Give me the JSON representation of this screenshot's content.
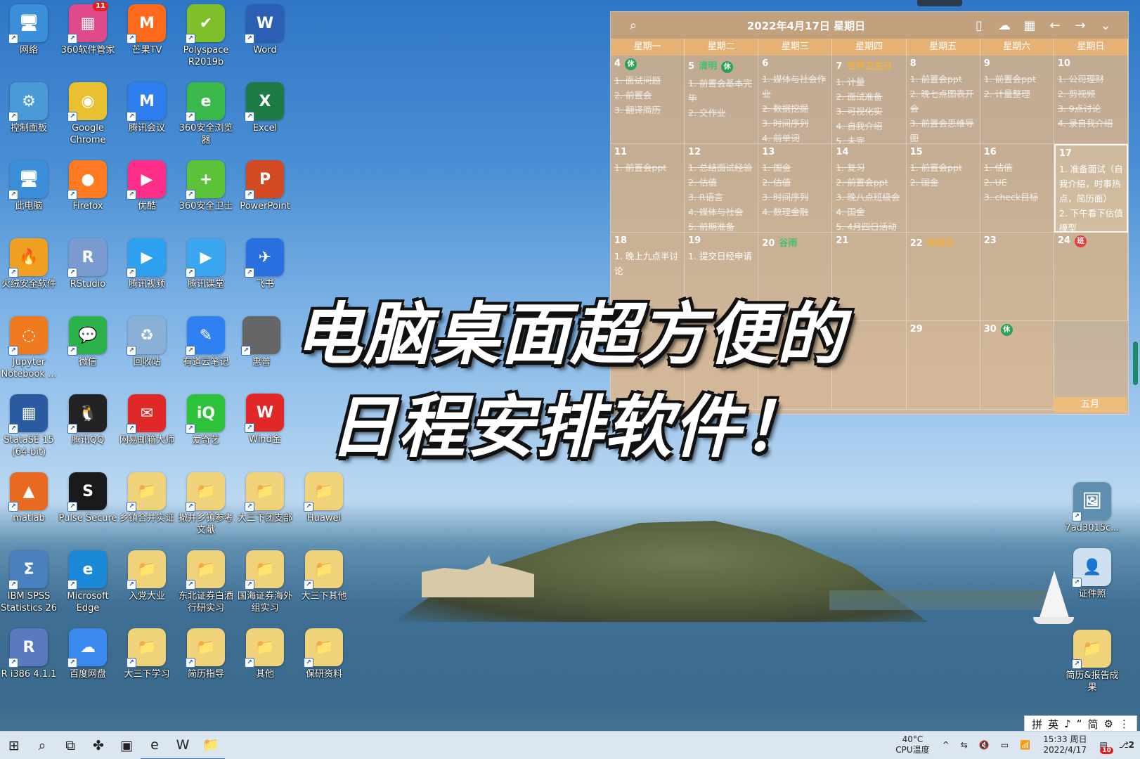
{
  "desktop_icons": [
    {
      "label": "网络",
      "glyph": "🖥",
      "color": "#3a8fd8",
      "col": 0,
      "row": 0
    },
    {
      "label": "360软件管家",
      "glyph": "▦",
      "color": "#e04a8a",
      "col": 1,
      "row": 0,
      "badge": "11"
    },
    {
      "label": "芒果TV",
      "glyph": "M",
      "color": "#ff6a1a",
      "col": 2,
      "row": 0
    },
    {
      "label": "Polyspace R2019b",
      "glyph": "✔",
      "color": "#7fbf2a",
      "col": 3,
      "row": 0
    },
    {
      "label": "Word",
      "glyph": "W",
      "color": "#2b5fb4",
      "col": 4,
      "row": 0
    },
    {
      "label": "控制面板",
      "glyph": "⚙",
      "color": "#4a9ad8",
      "col": 0,
      "row": 1
    },
    {
      "label": "Google Chrome",
      "glyph": "◉",
      "color": "#e8c030",
      "col": 1,
      "row": 1
    },
    {
      "label": "腾讯会议",
      "glyph": "M",
      "color": "#2f7ef0",
      "col": 2,
      "row": 1
    },
    {
      "label": "360安全浏览器",
      "glyph": "e",
      "color": "#3bb84a",
      "col": 3,
      "row": 1
    },
    {
      "label": "Excel",
      "glyph": "X",
      "color": "#1e7a45",
      "col": 4,
      "row": 1
    },
    {
      "label": "此电脑",
      "glyph": "🖥",
      "color": "#3a8fd8",
      "col": 0,
      "row": 2
    },
    {
      "label": "Firefox",
      "glyph": "●",
      "color": "#ff7a20",
      "col": 1,
      "row": 2
    },
    {
      "label": "优酷",
      "glyph": "▶",
      "color": "#ff2e88",
      "col": 2,
      "row": 2
    },
    {
      "label": "360安全卫士",
      "glyph": "+",
      "color": "#5cc23a",
      "col": 3,
      "row": 2
    },
    {
      "label": "PowerPoint",
      "glyph": "P",
      "color": "#d24a24",
      "col": 4,
      "row": 2
    },
    {
      "label": "火绒安全软件",
      "glyph": "🔥",
      "color": "#f0a020",
      "col": 0,
      "row": 3
    },
    {
      "label": "RStudio",
      "glyph": "R",
      "color": "#7a9ad0",
      "col": 1,
      "row": 3
    },
    {
      "label": "腾讯视频",
      "glyph": "▶",
      "color": "#2ea0f0",
      "col": 2,
      "row": 3
    },
    {
      "label": "腾讯课堂",
      "glyph": "▶",
      "color": "#3aa6f0",
      "col": 3,
      "row": 3
    },
    {
      "label": "飞书",
      "glyph": "✈",
      "color": "#2a6fe0",
      "col": 4,
      "row": 3
    },
    {
      "label": "Jupyter Notebook ...",
      "glyph": "◌",
      "color": "#f07a20",
      "col": 0,
      "row": 4
    },
    {
      "label": "微信",
      "glyph": "💬",
      "color": "#2bb24a",
      "col": 1,
      "row": 4
    },
    {
      "label": "回收站",
      "glyph": "♻",
      "color": "#8ab0d8",
      "col": 2,
      "row": 4
    },
    {
      "label": "有道云笔记",
      "glyph": "✎",
      "color": "#2f80f0",
      "col": 3,
      "row": 4
    },
    {
      "label": "StataSE 15 (64-bit)",
      "glyph": "▦",
      "color": "#2a5aa0",
      "col": 0,
      "row": 5
    },
    {
      "label": "腾讯QQ",
      "glyph": "🐧",
      "color": "#222222",
      "col": 1,
      "row": 5
    },
    {
      "label": "网易邮箱大师",
      "glyph": "✉",
      "color": "#e02828",
      "col": 2,
      "row": 5
    },
    {
      "label": "爱奇艺",
      "glyph": "iQ",
      "color": "#2cc23a",
      "col": 3,
      "row": 5
    },
    {
      "label": "matlab",
      "glyph": "▲",
      "color": "#e86a20",
      "col": 0,
      "row": 6
    },
    {
      "label": "Pulse Secure",
      "glyph": "S",
      "color": "#1a1a1a",
      "col": 1,
      "row": 6
    },
    {
      "label": "乡镇合并实证",
      "glyph": "📁",
      "color": "#f0d27a",
      "col": 2,
      "row": 6
    },
    {
      "label": "撤并乡镇参考文献",
      "glyph": "📁",
      "color": "#f0d27a",
      "col": 3,
      "row": 6
    },
    {
      "label": "大三下团支部",
      "glyph": "📁",
      "color": "#f0d27a",
      "col": 4,
      "row": 6
    },
    {
      "label": "Huawei",
      "glyph": "📁",
      "color": "#f0d27a",
      "col": 5,
      "row": 6
    },
    {
      "label": "IBM SPSS Statistics 26",
      "glyph": "Σ",
      "color": "#4a80c0",
      "col": 0,
      "row": 7
    },
    {
      "label": "Microsoft Edge",
      "glyph": "e",
      "color": "#1a8ad8",
      "col": 1,
      "row": 7
    },
    {
      "label": "入党大业",
      "glyph": "📁",
      "color": "#f0d27a",
      "col": 2,
      "row": 7
    },
    {
      "label": "东北证券白酒行研实习",
      "glyph": "📁",
      "color": "#f0d27a",
      "col": 3,
      "row": 7
    },
    {
      "label": "国海证券海外组实习",
      "glyph": "📁",
      "color": "#f0d27a",
      "col": 4,
      "row": 7
    },
    {
      "label": "大三下其他",
      "glyph": "📁",
      "color": "#f0d27a",
      "col": 5,
      "row": 7
    },
    {
      "label": "R i386 4.1.1",
      "glyph": "R",
      "color": "#5a7ac0",
      "col": 0,
      "row": 8
    },
    {
      "label": "百度网盘",
      "glyph": "☁",
      "color": "#3a8af0",
      "col": 1,
      "row": 8
    },
    {
      "label": "大三下学习",
      "glyph": "📁",
      "color": "#f0d27a",
      "col": 2,
      "row": 8
    },
    {
      "label": "简历指导",
      "glyph": "📁",
      "color": "#f0d27a",
      "col": 3,
      "row": 8
    },
    {
      "label": "其他",
      "glyph": "📁",
      "color": "#f0d27a",
      "col": 4,
      "row": 8
    },
    {
      "label": "保研资料",
      "glyph": "📁",
      "color": "#f0d27a",
      "col": 5,
      "row": 8
    }
  ],
  "partial_icons": [
    {
      "label": "惠普",
      "glyph": "",
      "color": "#666666"
    },
    {
      "label": "Wind金",
      "glyph": "W",
      "color": "#e02828"
    }
  ],
  "right_icons": [
    {
      "label": "7ad3015c...",
      "glyph": "🖼",
      "color": "#5f8fb0"
    },
    {
      "label": "证件照",
      "glyph": "👤",
      "color": "#cfe0f0"
    },
    {
      "label": "简历&报告成果",
      "glyph": "📁",
      "color": "#f0d27a"
    }
  ],
  "calendar": {
    "title": "2022年4月17日 星期日",
    "toolbar": [
      "search-icon",
      "phone-icon",
      "cloud-icon",
      "calendar-icon",
      "arrow-left-icon",
      "arrow-right-icon",
      "chevron-down-icon"
    ],
    "weekdays": [
      "星期一",
      "星期二",
      "星期三",
      "星期四",
      "星期五",
      "星期六",
      "星期日"
    ],
    "month_button": "五月",
    "days": [
      {
        "n": "4",
        "tag": "休",
        "tagType": "rest",
        "tasks": [
          "1. 面试问题",
          "2. 前置会",
          "3. 翻译简历"
        ]
      },
      {
        "n": "5",
        "tag": "清明",
        "tagType": "fest2",
        "tag2": "休",
        "tasks": [
          "1. 前置会基本完毕",
          "2. 交作业"
        ]
      },
      {
        "n": "6",
        "tasks": [
          "1. 媒体与社会作业",
          "2. 数据挖掘",
          "3. 时间序列",
          "4. 前单词"
        ]
      },
      {
        "n": "7",
        "tag": "世界卫生日",
        "tagType": "fest",
        "tasks": [
          "1. 计量",
          "2. 面试准备",
          "3. 可视化实",
          "4. 自我介绍",
          "5. 未完"
        ]
      },
      {
        "n": "8",
        "tasks": [
          "1. 前置会ppt",
          "2. 晚七点图表开会",
          "3. 前置会思维导图"
        ]
      },
      {
        "n": "9",
        "tasks": [
          "1. 前置会ppt",
          "2. 计量整理"
        ]
      },
      {
        "n": "10",
        "tasks": [
          "1. 公司理财",
          "2. 剪视频",
          "3. 9点讨论",
          "4. 录自我介绍"
        ]
      },
      {
        "n": "11",
        "tasks": [
          "1. 前置会ppt"
        ]
      },
      {
        "n": "12",
        "tasks": [
          "1. 总结面试经验",
          "2. 估值",
          "3. R语言",
          "4. 媒体与社会",
          "5. 前期准备"
        ]
      },
      {
        "n": "13",
        "tasks": [
          "1. 国金",
          "2. 估值",
          "3. 时间序列",
          "4. 数理金融"
        ]
      },
      {
        "n": "14",
        "tasks": [
          "1. 复习",
          "2. 前置会ppt",
          "3. 晚八点班级会",
          "4. 国金",
          "5. 4月四日活动"
        ]
      },
      {
        "n": "15",
        "tasks": [
          "1. 前置会ppt",
          "2. 国金"
        ]
      },
      {
        "n": "16",
        "tasks": [
          "1. 估值",
          "2. UE",
          "3. check目标"
        ]
      },
      {
        "n": "17",
        "today": true,
        "tasks": [
          "1. 准备面试（自我介绍，时事热点，简历面）",
          "2. 下午看下估值模型"
        ]
      },
      {
        "n": "18",
        "live": true,
        "tasks": [
          "1. 晚上九点半讨论"
        ]
      },
      {
        "n": "19",
        "live": true,
        "tasks": [
          "1. 提交日经申请"
        ]
      },
      {
        "n": "20",
        "tag": "谷雨",
        "tagType": "fest2",
        "tasks": []
      },
      {
        "n": "21",
        "tasks": []
      },
      {
        "n": "22",
        "tag": "地球日",
        "tagType": "fest",
        "tasks": []
      },
      {
        "n": "23",
        "tasks": []
      },
      {
        "n": "24",
        "tag": "班",
        "tagType": "work",
        "tasks": []
      },
      {
        "n": "",
        "tasks": []
      },
      {
        "n": "",
        "tasks": []
      },
      {
        "n": "",
        "tasks": []
      },
      {
        "n": "",
        "tasks": []
      },
      {
        "n": "29",
        "tasks": []
      },
      {
        "n": "30",
        "tag": "休",
        "tagType": "rest",
        "tasks": []
      },
      {
        "n": "",
        "blank": true,
        "tasks": []
      }
    ]
  },
  "headline": {
    "line1": "电脑桌面超方便的",
    "line2": "日程安排软件！"
  },
  "taskbar": {
    "apps": [
      {
        "glyph": "⊞",
        "name": "start-button"
      },
      {
        "glyph": "⌕",
        "name": "search-button"
      },
      {
        "glyph": "⧉",
        "name": "task-view-button"
      },
      {
        "glyph": "✤",
        "name": "widget-button"
      },
      {
        "glyph": "▣",
        "name": "photos-app"
      },
      {
        "glyph": "e",
        "name": "edge-app"
      },
      {
        "glyph": "W",
        "name": "word-app"
      },
      {
        "glyph": "📁",
        "name": "explorer-app"
      }
    ],
    "temp": "40°C",
    "temp_label": "CPU温度",
    "time": "15:33 周日",
    "date": "2022/4/17",
    "tray": [
      "^",
      "⇆",
      "🔇",
      "▭",
      "📶"
    ],
    "notif": "10",
    "desktop_num": "2"
  },
  "ime": [
    "拼",
    "英",
    "♪",
    "“",
    "简",
    "⚙",
    "⋮"
  ]
}
